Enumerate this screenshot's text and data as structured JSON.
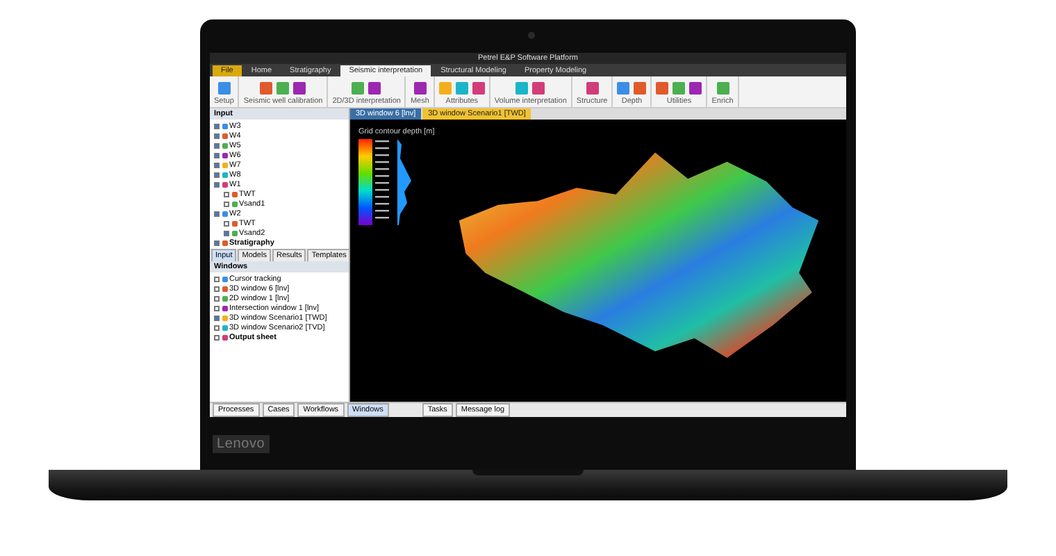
{
  "window": {
    "title": "Petrel E&P Software Platform"
  },
  "ribbon_tabs": [
    {
      "label": "File",
      "selected": false,
      "kind": "file"
    },
    {
      "label": "Home",
      "selected": false,
      "kind": "tab"
    },
    {
      "label": "Stratigraphy",
      "selected": false,
      "kind": "tab"
    },
    {
      "label": "Seismic interpretation",
      "selected": true,
      "kind": "tab"
    },
    {
      "label": "Structural Modeling",
      "selected": false,
      "kind": "tab"
    },
    {
      "label": "Property Modeling",
      "selected": false,
      "kind": "tab"
    }
  ],
  "ribbon_groups": [
    {
      "label": "Setup"
    },
    {
      "label": "Seismic well calibration"
    },
    {
      "label": "2D/3D interpretation"
    },
    {
      "label": "Mesh"
    },
    {
      "label": "Attributes"
    },
    {
      "label": "Volume interpretation"
    },
    {
      "label": "Structure"
    },
    {
      "label": "Depth"
    },
    {
      "label": "Utilities"
    },
    {
      "label": "Enrich"
    }
  ],
  "input_panel": {
    "title": "Input",
    "items": [
      {
        "label": "W3",
        "checked": true
      },
      {
        "label": "W4",
        "checked": true
      },
      {
        "label": "W5",
        "checked": true
      },
      {
        "label": "W6",
        "checked": true
      },
      {
        "label": "W7",
        "checked": true
      },
      {
        "label": "W8",
        "checked": true
      },
      {
        "label": "W1",
        "checked": true,
        "children": [
          {
            "label": "TWT",
            "checked": false
          },
          {
            "label": "Vsand1",
            "checked": false
          }
        ]
      },
      {
        "label": "W2",
        "checked": true,
        "children": [
          {
            "label": "TWT",
            "checked": false
          },
          {
            "label": "Vsand2",
            "checked": true
          }
        ]
      },
      {
        "label": "Stratigraphy",
        "checked": true
      }
    ],
    "tabs": [
      {
        "label": "Input",
        "selected": true
      },
      {
        "label": "Models",
        "selected": false
      },
      {
        "label": "Results",
        "selected": false
      },
      {
        "label": "Templates",
        "selected": false
      }
    ]
  },
  "windows_panel": {
    "title": "Windows",
    "items": [
      {
        "label": "Cursor tracking",
        "checked": false
      },
      {
        "label": "3D window 6 [lnv]",
        "checked": false
      },
      {
        "label": "2D window 1 [lnv]",
        "checked": false
      },
      {
        "label": "Intersection window 1 [lnv]",
        "checked": false
      },
      {
        "label": "3D window Scenario1 [TWD]",
        "checked": true
      },
      {
        "label": "3D window Scenario2 [TVD]",
        "checked": false
      },
      {
        "label": "Output sheet",
        "checked": false
      }
    ],
    "tabs": [
      {
        "label": "Processes",
        "selected": false
      },
      {
        "label": "Cases",
        "selected": false
      },
      {
        "label": "Workflows",
        "selected": false
      },
      {
        "label": "Windows",
        "selected": true
      }
    ]
  },
  "view_tabs": [
    {
      "label": "3D window 6 [lnv]",
      "selected": false
    },
    {
      "label": "3D window Scenario1 [TWD]",
      "selected": true
    }
  ],
  "legend": {
    "title": "Grid contour depth [m]"
  },
  "bottom_tabs": [
    {
      "label": "Tasks"
    },
    {
      "label": "Message log"
    }
  ],
  "logo": "Lenovo"
}
